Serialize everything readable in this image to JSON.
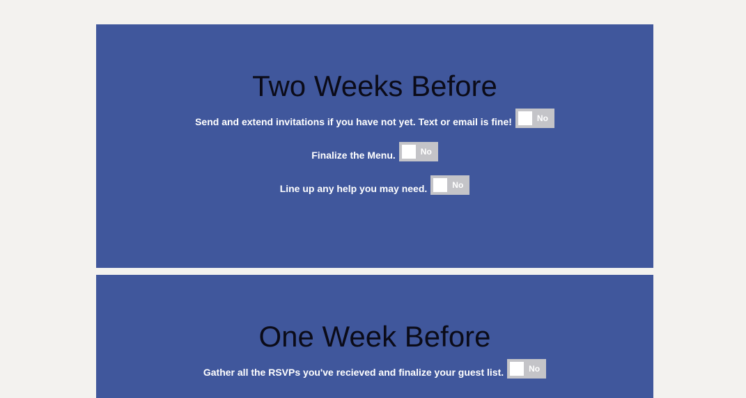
{
  "sections": [
    {
      "title": "Two Weeks Before",
      "tasks": [
        {
          "text": "Send and extend invitations if you have not yet. Text or email is fine!",
          "toggle": "No"
        },
        {
          "text": "Finalize the Menu.",
          "toggle": "No"
        },
        {
          "text": "Line up any help you may need.",
          "toggle": "No"
        }
      ]
    },
    {
      "title": "One Week Before",
      "tasks": [
        {
          "text": "Gather all the RSVPs you've recieved and finalize your guest list.",
          "toggle": "No"
        }
      ]
    }
  ],
  "colors": {
    "background": "#f3f2ef",
    "section": "#40579c",
    "heading": "#0b0b18",
    "toggle_off": "#c4c4c8"
  }
}
